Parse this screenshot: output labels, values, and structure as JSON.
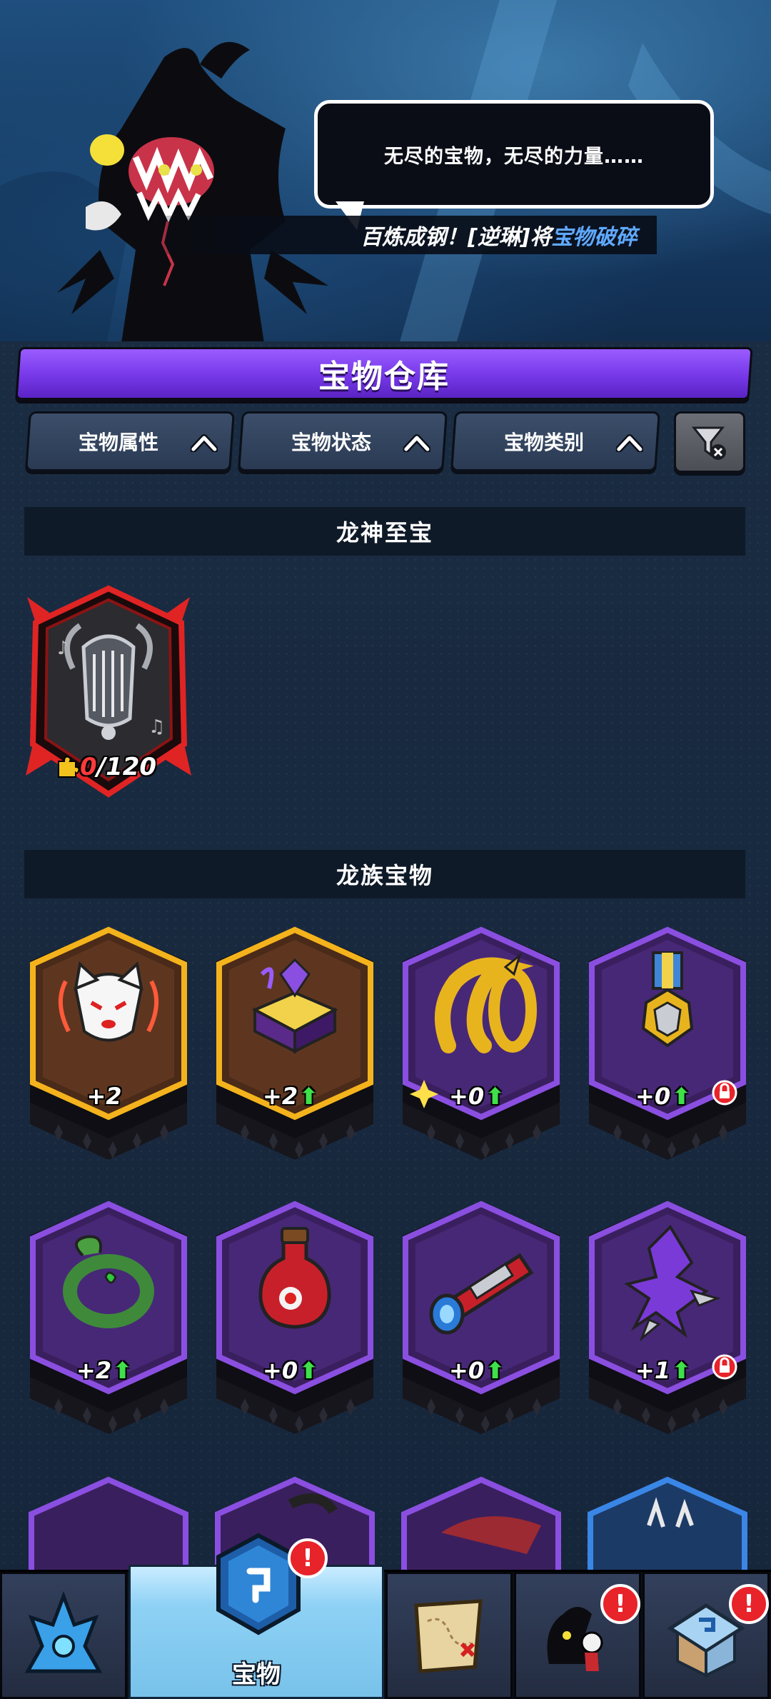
{
  "hero": {
    "speech": "无尽的宝物，无尽的力量……",
    "banner_prefix": "百炼成钢！[逆琳]将",
    "banner_accent": "宝物破碎"
  },
  "panel": {
    "title": "宝物仓库",
    "filters": [
      {
        "label": "宝物属性",
        "icon": "chevron-up-icon"
      },
      {
        "label": "宝物状态",
        "icon": "chevron-up-icon"
      },
      {
        "label": "宝物类别",
        "icon": "chevron-up-icon"
      }
    ],
    "clear_filter_icon": "filter-clear-icon"
  },
  "sections": [
    {
      "title": "龙神至宝",
      "items": [
        {
          "name": "harp",
          "count_current": "0",
          "count_total": "/120",
          "frame": "red",
          "icon": "puzzle-piece-icon"
        }
      ]
    },
    {
      "title": "龙族宝物",
      "items": [
        {
          "name": "fox-mask",
          "level": "+2",
          "upgradable": false,
          "rarity": "gold"
        },
        {
          "name": "dark-book",
          "level": "+2",
          "upgradable": true,
          "rarity": "gold"
        },
        {
          "name": "golden-horn",
          "level": "+0",
          "upgradable": true,
          "rarity": "purple",
          "sparkle": true
        },
        {
          "name": "medal",
          "level": "+0",
          "upgradable": true,
          "rarity": "purple",
          "locked": true
        },
        {
          "name": "serpent-ring",
          "level": "+2",
          "upgradable": true,
          "rarity": "purple"
        },
        {
          "name": "potion",
          "level": "+0",
          "upgradable": true,
          "rarity": "purple"
        },
        {
          "name": "red-scope",
          "level": "+0",
          "upgradable": true,
          "rarity": "purple"
        },
        {
          "name": "shadow-blade",
          "level": "+1",
          "upgradable": true,
          "rarity": "purple",
          "locked": true
        }
      ]
    }
  ],
  "up_glyph": "⬆",
  "colors": {
    "gold": "#f4b31d",
    "purple": "#8a4fe0",
    "red": "#e02424",
    "accent": "#7b3cf0"
  },
  "nav": {
    "tabs": [
      {
        "icon": "crystal-tower-icon",
        "label": ""
      },
      {
        "icon": "treasure-cube-icon",
        "label": "宝物",
        "active": true,
        "badge": "!"
      },
      {
        "icon": "treasure-map-icon",
        "label": ""
      },
      {
        "icon": "character-icon",
        "label": "",
        "badge": "!"
      },
      {
        "icon": "shop-house-icon",
        "label": "",
        "badge": "!"
      }
    ]
  }
}
